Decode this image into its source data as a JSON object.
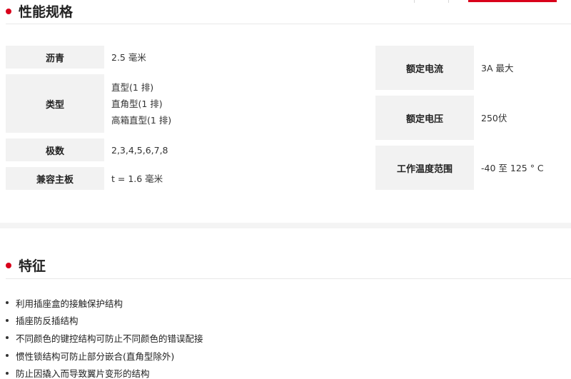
{
  "specs": {
    "title": "性能规格",
    "left": [
      {
        "label": "沥青",
        "values": [
          "2.5 毫米"
        ]
      },
      {
        "label": "类型",
        "values": [
          "直型(1 排)",
          "直角型(1 排)",
          "高箱直型(1 排)"
        ]
      },
      {
        "label": "极数",
        "values": [
          "2,3,4,5,6,7,8"
        ]
      },
      {
        "label": "兼容主板",
        "values": [
          "t = 1.6 毫米"
        ]
      }
    ],
    "right": [
      {
        "label": "额定电流",
        "values": [
          "3A 最大"
        ]
      },
      {
        "label": "额定电压",
        "values": [
          "250伏"
        ]
      },
      {
        "label": "工作温度范围",
        "values": [
          "-40 至 125 ° C"
        ]
      }
    ]
  },
  "features": {
    "title": "特征",
    "items": [
      "利用插座盒的接触保护结构",
      "插座防反插结构",
      "不同颜色的键控结构可防止不同颜色的错误配接",
      "惯性锁结构可防止部分嵌合(直角型除外)",
      "防止因撬入而导致翼片变形的结构"
    ]
  },
  "colors": {
    "accent": "#d9001b",
    "label_bg": "#f2f2f2"
  }
}
